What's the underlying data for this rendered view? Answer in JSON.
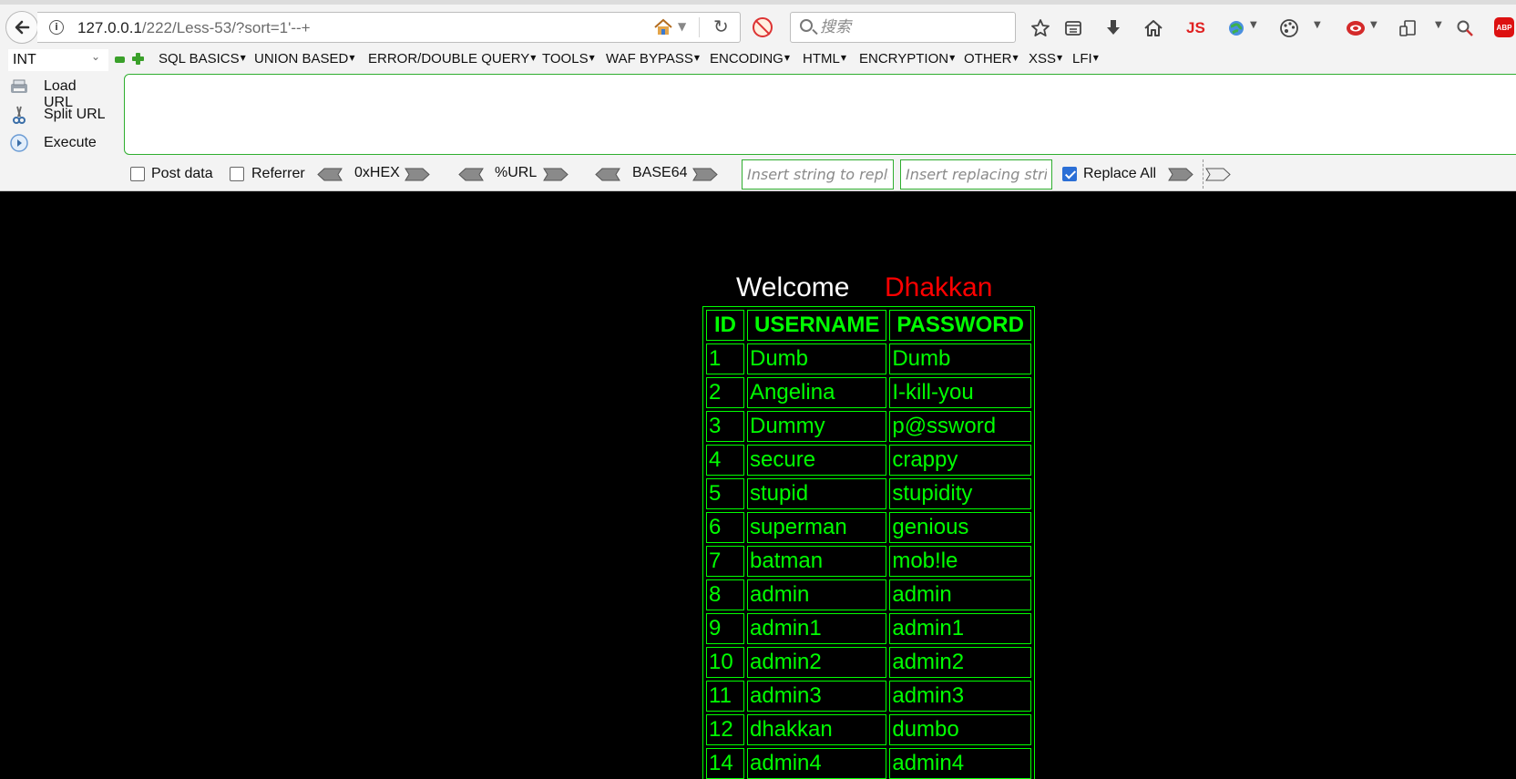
{
  "browser": {
    "url_host": "127.0.0.1",
    "url_path": "/222/Less-53/?sort=1'--+",
    "search_placeholder": "搜索",
    "toolbar_js_label": "JS",
    "toolbar_abp_label": "ABP"
  },
  "hackbar": {
    "type_select": "INT",
    "menus": [
      "SQL BASICS",
      "UNION BASED",
      "ERROR/DOUBLE QUERY",
      "TOOLS",
      "WAF BYPASS",
      "ENCODING",
      "HTML",
      "ENCRYPTION",
      "OTHER",
      "XSS",
      "LFI"
    ],
    "load_url": "Load URL",
    "split_url": "Split URL",
    "execute": "Execute",
    "post_data_label": "Post data",
    "referrer_label": "Referrer",
    "hex_label": "0xHEX",
    "url_label": "%URL",
    "base64_label": "BASE64",
    "replace_placeholder": "Insert string to replace",
    "replacing_placeholder": "Insert replacing string",
    "replace_all_label": "Replace All",
    "post_data_checked": false,
    "referrer_checked": false,
    "replace_all_checked": true
  },
  "page": {
    "welcome": "Welcome",
    "name": "Dhakkan",
    "headers": [
      "ID",
      "USERNAME",
      "PASSWORD"
    ],
    "rows": [
      [
        "1",
        "Dumb",
        "Dumb"
      ],
      [
        "2",
        "Angelina",
        "I-kill-you"
      ],
      [
        "3",
        "Dummy",
        "p@ssword"
      ],
      [
        "4",
        "secure",
        "crappy"
      ],
      [
        "5",
        "stupid",
        "stupidity"
      ],
      [
        "6",
        "superman",
        "genious"
      ],
      [
        "7",
        "batman",
        "mob!le"
      ],
      [
        "8",
        "admin",
        "admin"
      ],
      [
        "9",
        "admin1",
        "admin1"
      ],
      [
        "10",
        "admin2",
        "admin2"
      ],
      [
        "11",
        "admin3",
        "admin3"
      ],
      [
        "12",
        "dhakkan",
        "dumbo"
      ],
      [
        "14",
        "admin4",
        "admin4"
      ]
    ]
  },
  "colors": {
    "table_green": "#00ff00",
    "name_red": "#ff0000",
    "hackbar_border": "#2fae2f"
  }
}
